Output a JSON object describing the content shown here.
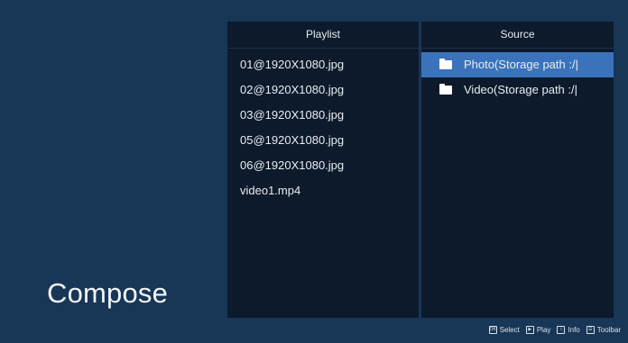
{
  "screen": {
    "title": "Compose"
  },
  "playlist": {
    "header": "Playlist",
    "items": [
      "01@1920X1080.jpg",
      "02@1920X1080.jpg",
      "03@1920X1080.jpg",
      "05@1920X1080.jpg",
      "06@1920X1080.jpg",
      "video1.mp4"
    ]
  },
  "source": {
    "header": "Source",
    "items": [
      {
        "label": "Photo(Storage path :/|",
        "icon": "folder-icon",
        "selected": true
      },
      {
        "label": "Video(Storage path :/|",
        "icon": "folder-icon",
        "selected": false
      }
    ]
  },
  "hints": [
    {
      "icon": "ok-icon",
      "glyph": "OK",
      "label": "Select"
    },
    {
      "icon": "play-icon",
      "glyph": "▶",
      "label": "Play"
    },
    {
      "icon": "info-icon",
      "glyph": "i",
      "label": "Info"
    },
    {
      "icon": "toolbar-icon",
      "glyph": "☰",
      "label": "Toolbar"
    }
  ],
  "colors": {
    "background": "#183656",
    "panel": "#0c1a2b",
    "selection": "#3a73bb"
  }
}
